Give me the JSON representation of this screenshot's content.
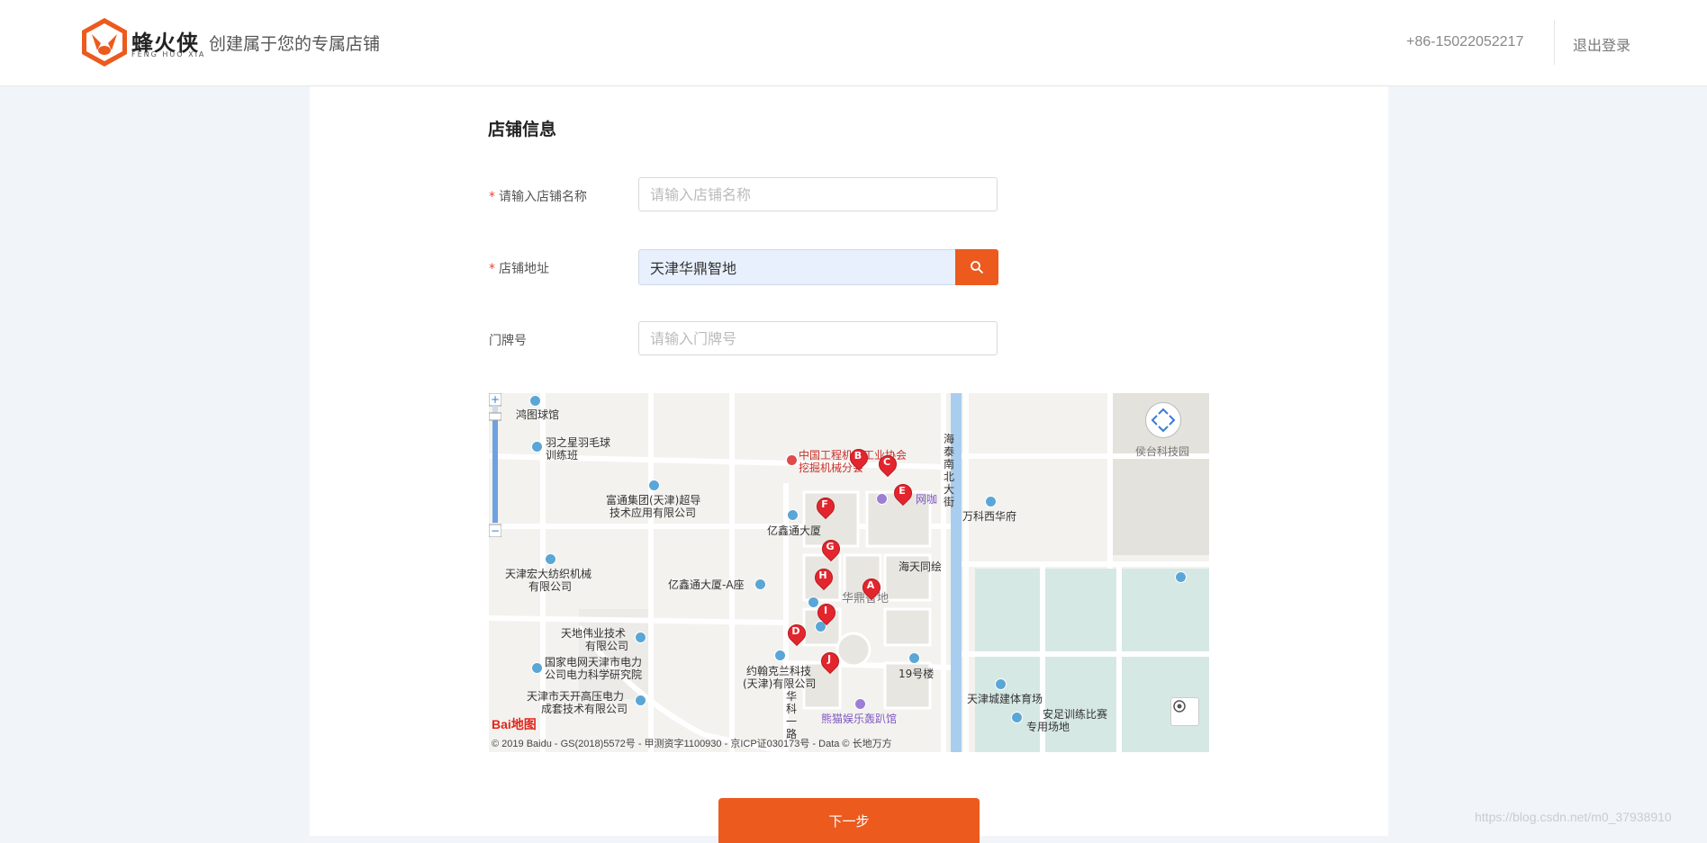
{
  "header": {
    "logo_text": "蜂火侠",
    "logo_sub": "FENG HUO XIA",
    "slogan": "创建属于您的专属店铺",
    "phone": "+86-15022052217",
    "logout_label": "退出登录"
  },
  "form": {
    "section_title": "店铺信息",
    "required_mark": "*",
    "store_name": {
      "label": "请输入店铺名称",
      "placeholder": "请输入店铺名称",
      "value": ""
    },
    "store_address": {
      "label": "店铺地址",
      "value": "天津华鼎智地"
    },
    "door_number": {
      "label": "门牌号",
      "placeholder": "请输入门牌号",
      "value": ""
    },
    "next_label": "下一步"
  },
  "map": {
    "baidu_logo": "Bai地图",
    "copyright": "© 2019 Baidu - GS(2018)5572号 - 甲测资字1100930 - 京ICP证030173号 - Data © 长地万方",
    "markers": [
      "A",
      "B",
      "C",
      "D",
      "E",
      "F",
      "G",
      "H",
      "I",
      "J"
    ],
    "labels": {
      "l1": "鸿图球馆",
      "l2": "羽之星羽毛球",
      "l2b": "训练班",
      "l3": "中国工程机械工业协会",
      "l3b": "挖掘机械分会",
      "l4": "富通集团(天津)超导",
      "l4b": "技术应用有限公司",
      "l5": "网咖",
      "l6": "亿鑫通大厦",
      "l7": "天津宏大纺织机械",
      "l7b": "有限公司",
      "l8": "亿鑫通大厦-A座",
      "l9": "海天同绘",
      "l10": "华鼎智地",
      "l11": "天地伟业技术",
      "l11b": "有限公司",
      "l12": "国家电网天津市电力",
      "l12b": "公司电力科学研究院",
      "l13": "约翰克兰科技",
      "l13b": "(天津)有限公司",
      "l14": "19号楼",
      "l15": "天津市天开高压电力",
      "l15b": "成套技术有限公司",
      "l16": "熊猫娱乐轰趴馆",
      "l17": "万科西华府",
      "l18": "海泰南北大街",
      "l19": "华科一路",
      "l20": "侯台科技园",
      "l21": "天津城建体育场",
      "l22": "安足训练比赛",
      "l22b": "专用场地"
    }
  },
  "watermark": "https://blog.csdn.net/m0_37938910"
}
